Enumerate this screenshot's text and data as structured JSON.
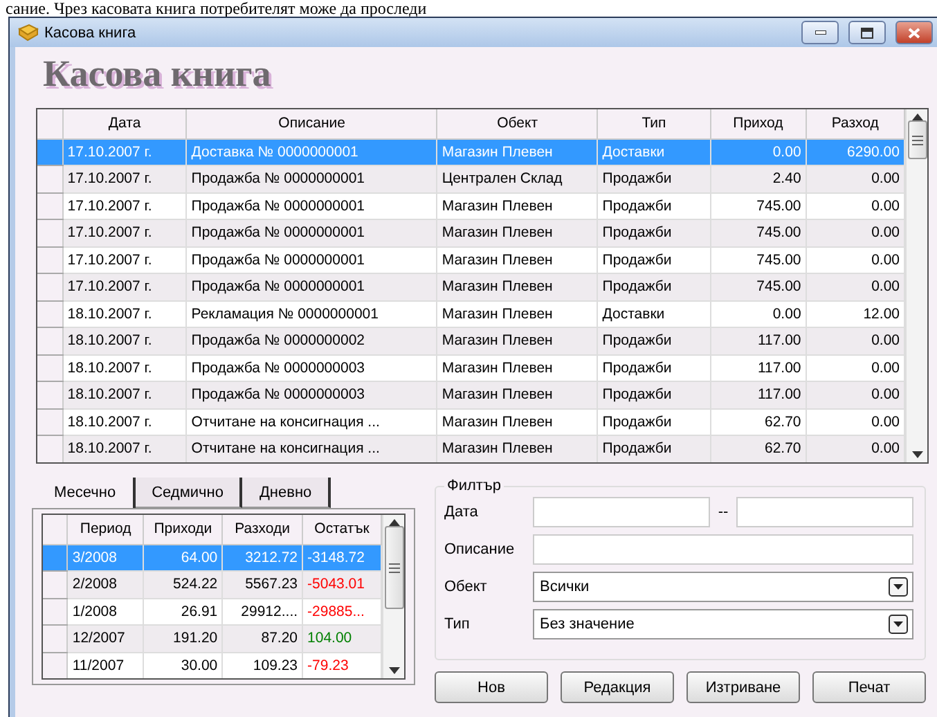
{
  "document_text": "сание.  Чрез касовата книга потребителят може да проследи",
  "window": {
    "title": "Касова книга"
  },
  "heading": "Касова книга",
  "table": {
    "columns": [
      "Дата",
      "Описание",
      "Обект",
      "Тип",
      "Приход",
      "Разход"
    ],
    "rows": [
      {
        "selected": true,
        "cells": [
          "17.10.2007 г.",
          "Доставка № 0000000001",
          "Магазин Плевен",
          "Доставки",
          "0.00",
          "6290.00"
        ]
      },
      {
        "selected": false,
        "cells": [
          "17.10.2007 г.",
          "Продажба № 0000000001",
          "Централен Склад",
          "Продажби",
          "2.40",
          "0.00"
        ]
      },
      {
        "selected": false,
        "cells": [
          "17.10.2007 г.",
          "Продажба № 0000000001",
          "Магазин Плевен",
          "Продажби",
          "745.00",
          "0.00"
        ]
      },
      {
        "selected": false,
        "cells": [
          "17.10.2007 г.",
          "Продажба № 0000000001",
          "Магазин Плевен",
          "Продажби",
          "745.00",
          "0.00"
        ]
      },
      {
        "selected": false,
        "cells": [
          "17.10.2007 г.",
          "Продажба № 0000000001",
          "Магазин Плевен",
          "Продажби",
          "745.00",
          "0.00"
        ]
      },
      {
        "selected": false,
        "cells": [
          "17.10.2007 г.",
          "Продажба № 0000000001",
          "Магазин Плевен",
          "Продажби",
          "745.00",
          "0.00"
        ]
      },
      {
        "selected": false,
        "cells": [
          "18.10.2007 г.",
          "Рекламация № 0000000001",
          "Магазин Плевен",
          "Доставки",
          "0.00",
          "12.00"
        ]
      },
      {
        "selected": false,
        "cells": [
          "18.10.2007 г.",
          "Продажба № 0000000002",
          "Магазин Плевен",
          "Продажби",
          "117.00",
          "0.00"
        ]
      },
      {
        "selected": false,
        "cells": [
          "18.10.2007 г.",
          "Продажба № 0000000003",
          "Магазин Плевен",
          "Продажби",
          "117.00",
          "0.00"
        ]
      },
      {
        "selected": false,
        "cells": [
          "18.10.2007 г.",
          "Продажба № 0000000003",
          "Магазин Плевен",
          "Продажби",
          "117.00",
          "0.00"
        ]
      },
      {
        "selected": false,
        "cells": [
          "18.10.2007 г.",
          "Отчитане на консигнация ...",
          "Магазин Плевен",
          "Продажби",
          "62.70",
          "0.00"
        ]
      },
      {
        "selected": false,
        "cells": [
          "18.10.2007 г.",
          "Отчитане на консигнация ...",
          "Магазин Плевен",
          "Продажби",
          "62.70",
          "0.00"
        ]
      }
    ]
  },
  "period_tabs": [
    {
      "label": "Месечно",
      "selected": true
    },
    {
      "label": "Седмично",
      "selected": false
    },
    {
      "label": "Дневно",
      "selected": false
    }
  ],
  "summary": {
    "columns": [
      "Период",
      "Приходи",
      "Разходи",
      "Остатък"
    ],
    "rows": [
      {
        "selected": true,
        "cells": [
          "3/2008",
          "64.00",
          "3212.72",
          "-3148.72"
        ]
      },
      {
        "selected": false,
        "color": "#ff0000",
        "cells": [
          "2/2008",
          "524.22",
          "5567.23",
          "-5043.01"
        ]
      },
      {
        "selected": false,
        "color": "#ff0000",
        "cells": [
          "1/2008",
          "26.91",
          "29912....",
          "-29885..."
        ]
      },
      {
        "selected": false,
        "color": "#008000",
        "cells": [
          "12/2007",
          "191.20",
          "87.20",
          "104.00"
        ]
      },
      {
        "selected": false,
        "color": "#ff0000",
        "cells": [
          "11/2007",
          "30.00",
          "109.23",
          "-79.23"
        ]
      }
    ]
  },
  "filter": {
    "title": "Филтър",
    "fields": [
      {
        "kind": "range",
        "label": "Дата",
        "separator": "--"
      },
      {
        "kind": "text",
        "label": "Описание"
      },
      {
        "kind": "select",
        "label": "Обект",
        "value": "Всички"
      },
      {
        "kind": "select",
        "label": "Тип",
        "value": "Без значение"
      }
    ]
  },
  "buttons": [
    "Нов",
    "Редакция",
    "Изтриване",
    "Печат"
  ]
}
